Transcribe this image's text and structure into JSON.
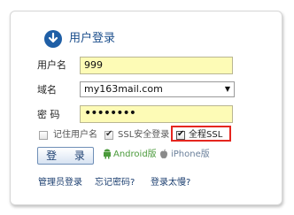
{
  "header": {
    "title": "用户登录"
  },
  "form": {
    "username_label": "用户名",
    "username_value": "999",
    "domain_label": "域名",
    "domain_value": "my163mail.com",
    "password_label": "密 码",
    "password_value": "••••••••"
  },
  "options": {
    "remember_label": "记住用户名",
    "ssl_security_label": "SSL安全登录",
    "full_ssl_label": "全程SSL"
  },
  "actions": {
    "login_label": "登 录",
    "android_label": "Android版",
    "iphone_label": "iPhone版"
  },
  "links": {
    "admin_login": "管理员登录",
    "forgot_password": "忘记密码?",
    "login_slow": "登录太慢?"
  },
  "colors": {
    "accent": "#1f5fa6",
    "field_bg": "#fdfbb6",
    "highlight": "#e5261f"
  }
}
